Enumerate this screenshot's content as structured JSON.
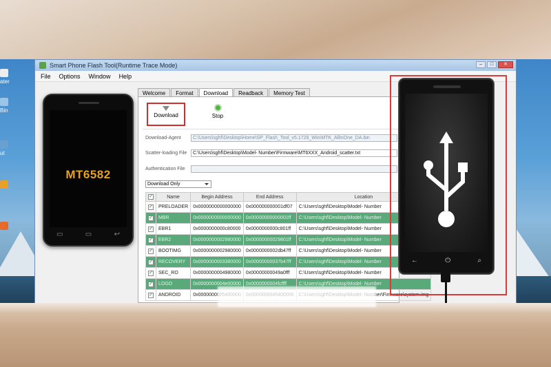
{
  "window": {
    "title": "Smart Phone Flash Tool(Runtime Trace Mode)",
    "controls": {
      "minimize": "–",
      "maximize": "□",
      "close": "✕"
    }
  },
  "menu": [
    "File",
    "Options",
    "Window",
    "Help"
  ],
  "desktop_icons": [
    "ater",
    "Bin",
    "ut"
  ],
  "device_left": {
    "model": "MT6582",
    "keys": [
      "▭",
      "▭",
      "↩"
    ]
  },
  "tabs": [
    {
      "label": "Welcome",
      "active": false
    },
    {
      "label": "Format",
      "active": false
    },
    {
      "label": "Download",
      "active": true
    },
    {
      "label": "Readback",
      "active": false
    },
    {
      "label": "Memory Test",
      "active": false
    }
  ],
  "toolbar": {
    "download_label": "Download",
    "stop_label": "Stop"
  },
  "form": {
    "download_agent": {
      "label": "Download-Agent",
      "value": "C:\\Users\\sghf\\Desktop\\Home\\SP_Flash_Tool_v5.1728_Win\\MTK_AllInOne_DA.bin"
    },
    "scatter_file": {
      "label": "Scatter-loading File",
      "value": "C:\\Users\\sghf\\Desktop\\Model- Number\\Firmware\\MT6XXX_Android_scatter.txt"
    },
    "auth_file": {
      "label": "Authentication File",
      "value": ""
    },
    "mode": "Download Only"
  },
  "table": {
    "headers": [
      "",
      "Name",
      "Begin Address",
      "End Address",
      "Location"
    ],
    "rows": [
      {
        "name": "PRELOADER",
        "begin": "0x0000000000000000",
        "end": "0x000000000001df07",
        "location": "C:\\Users\\sghf\\Desktop\\Model- Number",
        "style": "white"
      },
      {
        "name": "MBR",
        "begin": "0x0000000000000000",
        "end": "0x00000000000001ff",
        "location": "C:\\Users\\sghf\\Desktop\\Model- Number",
        "style": "green"
      },
      {
        "name": "EBR1",
        "begin": "0x0000000000c80000",
        "end": "0x0000000000c801ff",
        "location": "C:\\Users\\sghf\\Desktop\\Model- Number",
        "style": "white"
      },
      {
        "name": "EBR2",
        "begin": "0x0000000002980000",
        "end": "0x00000000029801ff",
        "location": "C:\\Users\\sghf\\Desktop\\Model- Number",
        "style": "green"
      },
      {
        "name": "BOOTIMG",
        "begin": "0x0000000002980000",
        "end": "0x0000000002db47ff",
        "location": "C:\\Users\\sghf\\Desktop\\Model- Number",
        "style": "white"
      },
      {
        "name": "RECOVERY",
        "begin": "0x0000000003380000",
        "end": "0x00000000037b47ff",
        "location": "C:\\Users\\sghf\\Desktop\\Model- Number",
        "style": "green"
      },
      {
        "name": "SEC_RO",
        "begin": "0x0000000004980000",
        "end": "0x00000000049a0fff",
        "location": "C:\\Users\\sghf\\Desktop\\Model- Number",
        "style": "white"
      },
      {
        "name": "LOGO",
        "begin": "0x0000000004e00000",
        "end": "0x0000000004fcffff",
        "location": "C:\\Users\\sghf\\Desktop\\Model- Number",
        "style": "green"
      },
      {
        "name": "ANDROID",
        "begin": "0x0000000005400000",
        "end": "0x0000000045400000",
        "location": "C:\\Users\\sghf\\Desktop\\Model- Number\\Firmware\\system.img",
        "style": "white"
      }
    ]
  },
  "device_right": {
    "icon": "usb-icon",
    "keys": [
      "←",
      "⏻",
      "⌕"
    ]
  }
}
